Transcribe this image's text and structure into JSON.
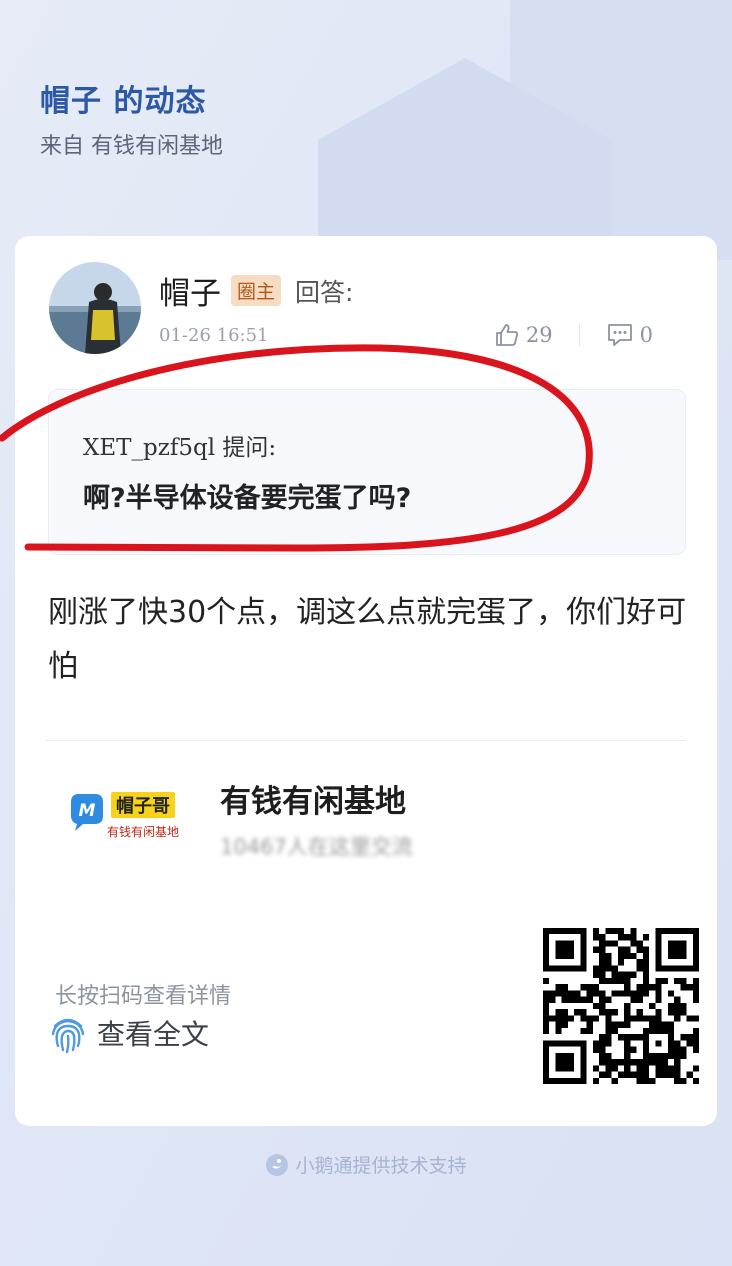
{
  "header": {
    "title": "帽子 的动态",
    "subtitle": "来自 有钱有闲基地"
  },
  "post": {
    "author": "帽子",
    "badge": "圈主",
    "action": "回答:",
    "time": "01-26 16:51",
    "likes": "29",
    "comments": "0"
  },
  "question": {
    "asker": "XET_pzf5ql 提问:",
    "text": "啊?半导体设备要完蛋了吗?"
  },
  "answer": {
    "text": "刚涨了快30个点，调这么点就完蛋了，你们好可怕"
  },
  "group": {
    "name": "有钱有闲基地",
    "desc": "10467人在这里交流",
    "logo_line1": "帽子哥",
    "logo_line2": "有钱有闲基地",
    "logo_mark": "M"
  },
  "footer_actions": {
    "scan_hint": "长按扫码查看详情",
    "view_full": "查看全文"
  },
  "footer": {
    "powered_by": "小鹅通提供技术支持"
  },
  "colors": {
    "accent": "#2c59a6",
    "badge_bg": "#f8dcc2",
    "badge_text": "#b05a1e",
    "annotation_red": "#d9141c"
  }
}
